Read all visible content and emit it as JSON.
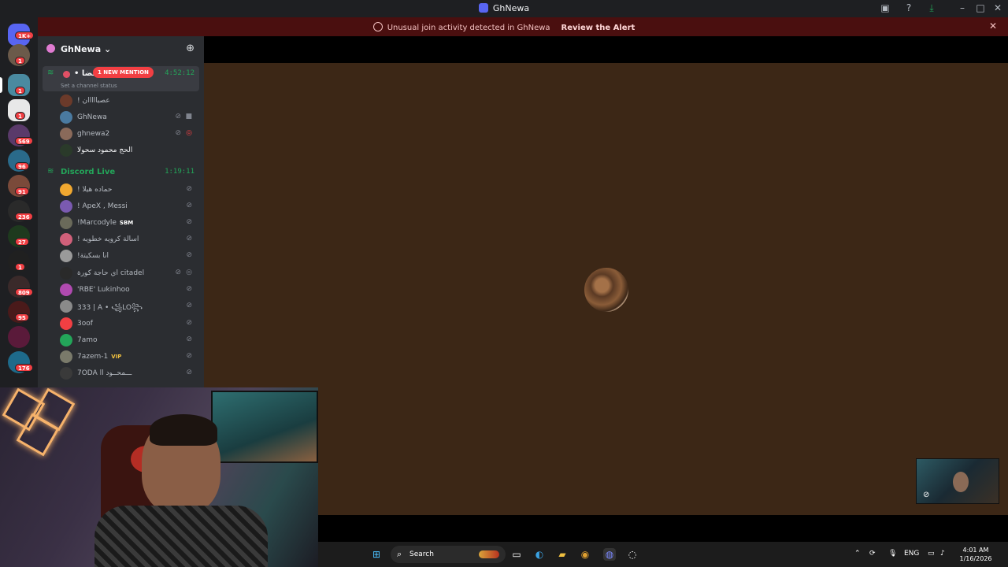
{
  "window": {
    "title": "GhNewa"
  },
  "alert": {
    "message": "Unusual join activity detected in GhNewa",
    "action": "Review the Alert"
  },
  "rail": {
    "badges": [
      "1K+",
      "1",
      "1",
      "1",
      "569",
      "96",
      "91",
      "236",
      "27",
      "1",
      "809",
      "95",
      "176"
    ]
  },
  "server": {
    "name": "GhNewa",
    "mention_badge": "1 NEW MENTION"
  },
  "channels": [
    {
      "name": "• قضا",
      "time": "4:52:12",
      "status": "Set a channel status",
      "members": [
        {
          "name": "! عصبااااان"
        },
        {
          "name": "GhNewa"
        },
        {
          "name": "ghnewa2"
        },
        {
          "name": "الحج محمود سحولا"
        }
      ]
    },
    {
      "name": "Discord Live",
      "time": "1:19:11",
      "members": [
        {
          "name": "! حماده هيلا"
        },
        {
          "name": "! ApeX , Messi"
        },
        {
          "name": "!Marcodyle",
          "tag": "SBM"
        },
        {
          "name": "! اسالة كرويه خطويه"
        },
        {
          "name": "!انا بسكيتة"
        },
        {
          "name": "اي حاجة كورة citadel"
        },
        {
          "name": "'RBE' Lukinhoo"
        },
        {
          "name": "333 | A • ꧁LO꧂"
        },
        {
          "name": "3oof"
        },
        {
          "name": "7amo"
        },
        {
          "name": "7azem-1",
          "tag": "VIP"
        },
        {
          "name": "7ODA ll ـــمحــود"
        }
      ]
    }
  ],
  "taskbar": {
    "search_placeholder": "Search",
    "lang": "ENG",
    "time": "4:01 AM",
    "date": "1/16/2026"
  },
  "colors": {
    "alert_bg": "#4a0f0f",
    "stage_bg": "#3c2716",
    "sidebar_bg": "#2b2d31",
    "voice_green": "#23a559",
    "mention_red": "#f23f43"
  }
}
